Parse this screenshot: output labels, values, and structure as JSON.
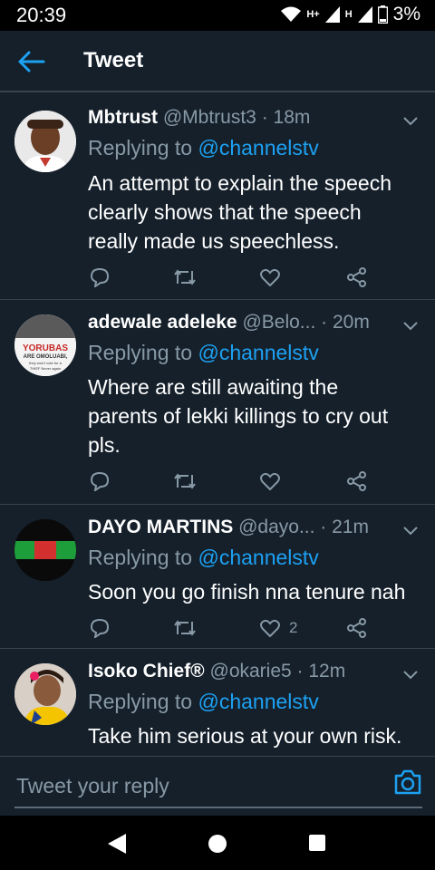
{
  "status_bar": {
    "time": "20:39",
    "network_label_1": "H+",
    "network_label_2": "H",
    "battery": "3%"
  },
  "header": {
    "title": "Tweet"
  },
  "tweets": [
    {
      "name": "Mbtrust",
      "handle": "@Mbtrust3",
      "time": "· 18m",
      "replying_prefix": "Replying to ",
      "replying_to": "@channelstv",
      "lines": [
        "An attempt to explain the speech",
        "clearly shows that the speech",
        "really made us speechless."
      ],
      "like_count": ""
    },
    {
      "name": "adewale adeleke",
      "handle": "@Belo...",
      "time": "· 20m",
      "replying_prefix": "Replying to ",
      "replying_to": "@channelstv",
      "lines": [
        "Where are still awaiting the",
        "parents of lekki killings to cry out",
        "pls."
      ],
      "like_count": "",
      "avatar_text": [
        "YORUBAS",
        "ARE OMOLUABI,",
        "they won't vote for a",
        "THIEF Never again"
      ]
    },
    {
      "name": "DAYO MARTINS",
      "handle": "@dayo...",
      "time": "· 21m",
      "replying_prefix": "Replying to ",
      "replying_to": "@channelstv",
      "lines": [
        "Soon you go finish nna tenure nah"
      ],
      "like_count": "2"
    },
    {
      "name": "Isoko Chief®",
      "handle": "@okarie5",
      "time": "· 12m",
      "replying_prefix": "Replying to ",
      "replying_to": "@channelstv",
      "lines": [
        "Take him serious at your own risk."
      ]
    }
  ],
  "compose": {
    "placeholder": "Tweet your reply"
  },
  "icons": {
    "back": "arrow-left-icon",
    "camera": "camera-icon",
    "reply": "reply-icon",
    "retweet": "retweet-icon",
    "like": "heart-icon",
    "share": "share-icon",
    "caret": "chevron-down-icon"
  },
  "colors": {
    "background": "#15202b",
    "accent": "#1da1f2",
    "secondary_text": "#8899a6",
    "divider": "#38444d"
  }
}
